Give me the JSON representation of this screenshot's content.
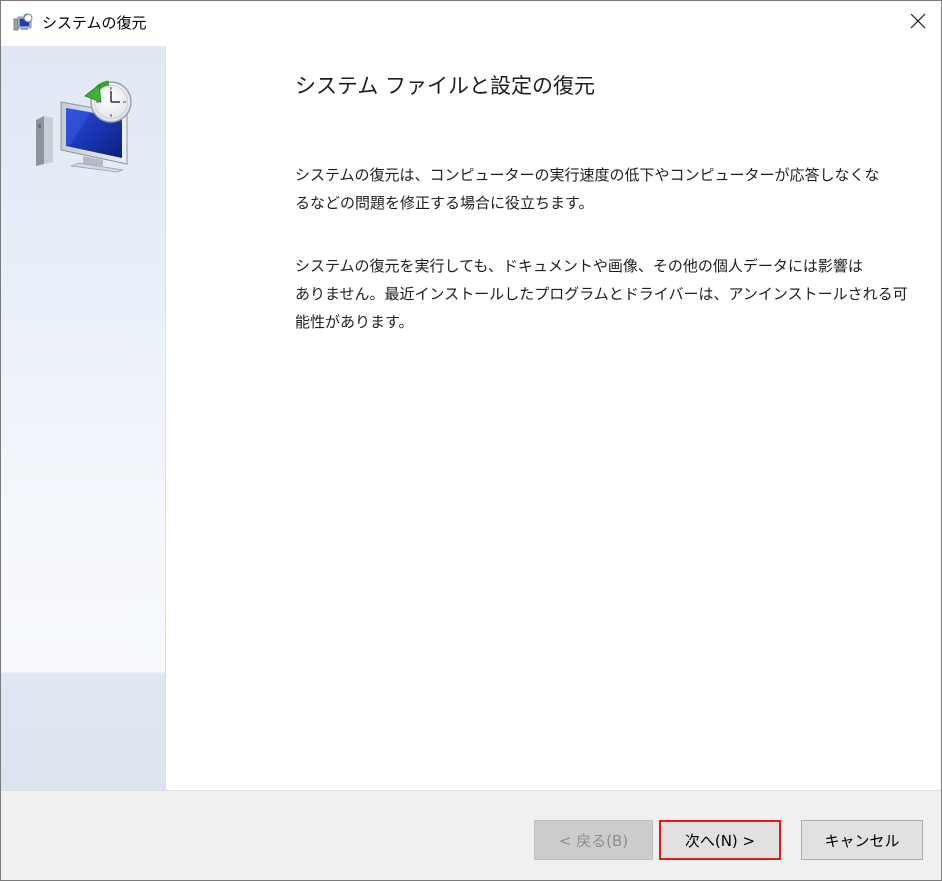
{
  "window": {
    "title": "システムの復元",
    "icon": "system-restore-icon",
    "close_icon": "close-icon"
  },
  "sidebar": {
    "graphic": "monitor-with-clock-restore-icon"
  },
  "main": {
    "heading": "システム ファイルと設定の復元",
    "paragraph1": [
      "システムの復元は、コンピューターの実行速度の低下やコンピューターが応答しなくな",
      "るなどの問題を修正する場合に役立ちます。"
    ],
    "paragraph2": [
      "システムの復元を実行しても、ドキュメントや画像、その他の個人データには影響は",
      "ありません。最近インストールしたプログラムとドライバーは、アンインストールされる可",
      "能性があります。"
    ]
  },
  "footer": {
    "back_label": "< 戻る(B)",
    "next_label": "次へ(N) >",
    "cancel_label": "キャンセル",
    "highlight_color": "#e21a1a"
  }
}
